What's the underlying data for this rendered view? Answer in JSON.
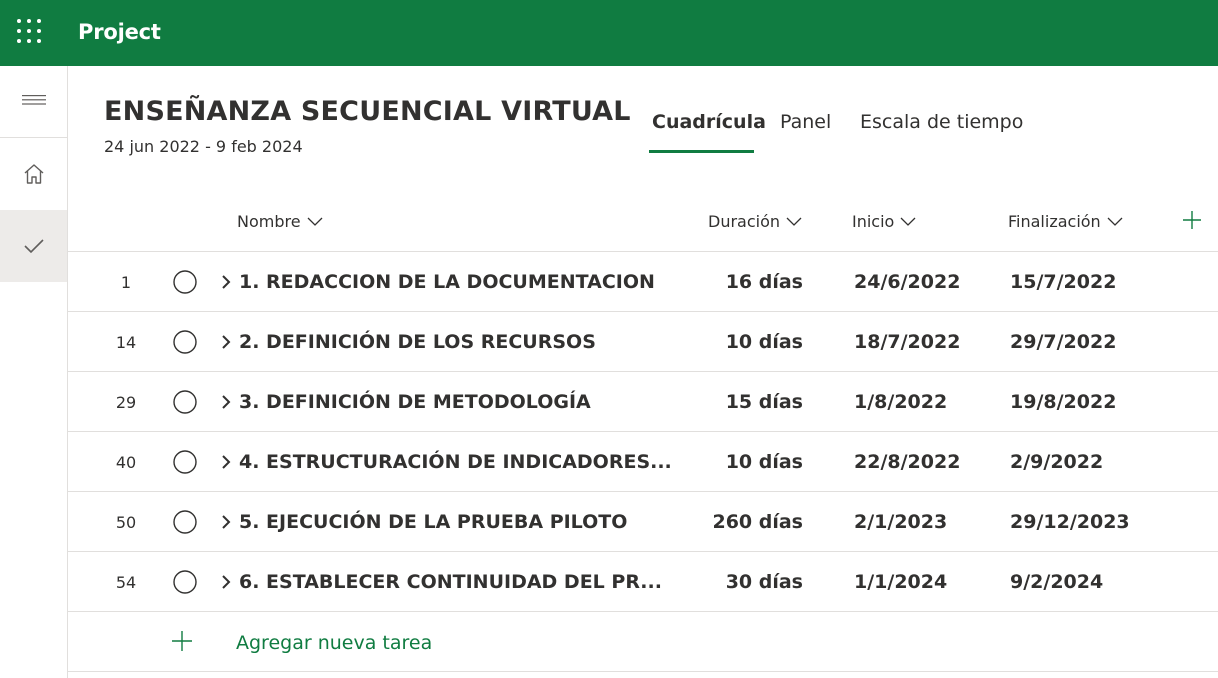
{
  "app": {
    "title": "Project"
  },
  "rail": {
    "items": [
      {
        "icon": "hamburger-menu-icon"
      },
      {
        "icon": "home-icon"
      },
      {
        "icon": "checkmark-icon",
        "active": true
      }
    ]
  },
  "plan": {
    "title": "ENSEÑANZA SECUENCIAL VIRTUAL",
    "dates": "24 jun 2022 - 9 feb 2024"
  },
  "tabs": [
    {
      "label": "Cuadrícula",
      "active": true
    },
    {
      "label": "Panel"
    },
    {
      "label": "Escala de tiempo"
    }
  ],
  "columns": {
    "name": "Nombre",
    "duration": "Duración",
    "start": "Inicio",
    "end": "Finalización"
  },
  "tasks": [
    {
      "id": "1",
      "name": "1. REDACCION DE LA DOCUMENTACION",
      "duration": "16 días",
      "start": "24/6/2022",
      "end": "15/7/2022"
    },
    {
      "id": "14",
      "name": "2. DEFINICIÓN DE LOS RECURSOS",
      "duration": "10 días",
      "start": "18/7/2022",
      "end": "29/7/2022"
    },
    {
      "id": "29",
      "name": "3. DEFINICIÓN DE METODOLOGÍA",
      "duration": "15 días",
      "start": "1/8/2022",
      "end": "19/8/2022"
    },
    {
      "id": "40",
      "name": "4. ESTRUCTURACIÓN DE INDICADORES...",
      "duration": "10 días",
      "start": "22/8/2022",
      "end": "2/9/2022"
    },
    {
      "id": "50",
      "name": "5. EJECUCIÓN DE LA PRUEBA PILOTO",
      "duration": "260 días",
      "start": "2/1/2023",
      "end": "29/12/2023"
    },
    {
      "id": "54",
      "name": "6. ESTABLECER CONTINUIDAD DEL PR...",
      "duration": "30 días",
      "start": "1/1/2024",
      "end": "9/2/2024"
    }
  ],
  "add_task": {
    "label": "Agregar nueva tarea"
  },
  "colors": {
    "brand": "#107c41",
    "text": "#323130",
    "divider": "#e1dfdd"
  }
}
